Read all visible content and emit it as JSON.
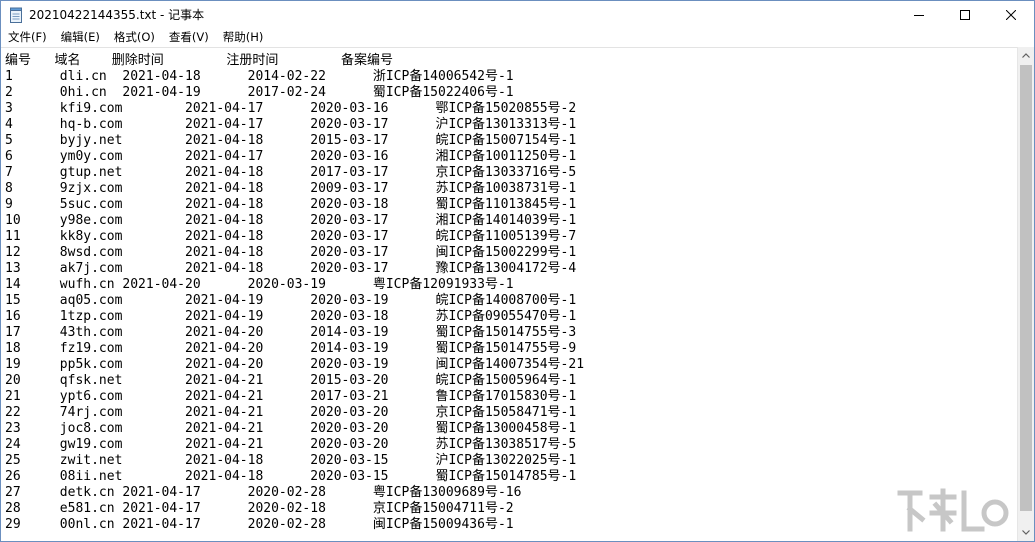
{
  "window": {
    "title": "20210422144355.txt - 记事本"
  },
  "menu": [
    {
      "label": "文件(F)"
    },
    {
      "label": "编辑(E)"
    },
    {
      "label": "格式(O)"
    },
    {
      "label": "查看(V)"
    },
    {
      "label": "帮助(H)"
    }
  ],
  "editor": {
    "lines": [
      "编号   域名    删除时间        注册时间        备案编号",
      "1      dli.cn  2021-04-18      2014-02-22      浙ICP备14006542号-1",
      "2      0hi.cn  2021-04-19      2017-02-24      蜀ICP备15022406号-1",
      "3      kfi9.com        2021-04-17      2020-03-16      鄂ICP备15020855号-2",
      "4      hq-b.com        2021-04-17      2020-03-17      沪ICP备13013313号-1",
      "5      byjy.net        2021-04-18      2015-03-17      皖ICP备15007154号-1",
      "6      ym0y.com        2021-04-17      2020-03-16      湘ICP备10011250号-1",
      "7      gtup.net        2021-04-18      2017-03-17      京ICP备13033716号-5",
      "8      9zjx.com        2021-04-18      2009-03-17      苏ICP备10038731号-1",
      "9      5suc.com        2021-04-18      2020-03-18      蜀ICP备11013845号-1",
      "10     y98e.com        2021-04-18      2020-03-17      湘ICP备14014039号-1",
      "11     kk8y.com        2021-04-18      2020-03-17      皖ICP备11005139号-7",
      "12     8wsd.com        2021-04-18      2020-03-17      闽ICP备15002299号-1",
      "13     ak7j.com        2021-04-18      2020-03-17      豫ICP备13004172号-4",
      "14     wufh.cn 2021-04-20      2020-03-19      粤ICP备12091933号-1",
      "15     aq05.com        2021-04-19      2020-03-19      皖ICP备14008700号-1",
      "16     1tzp.com        2021-04-19      2020-03-18      苏ICP备09055470号-1",
      "17     43th.com        2021-04-20      2014-03-19      蜀ICP备15014755号-3",
      "18     fz19.com        2021-04-20      2014-03-19      蜀ICP备15014755号-9",
      "19     pp5k.com        2021-04-20      2020-03-19      闽ICP备14007354号-21",
      "20     qfsk.net        2021-04-21      2015-03-20      皖ICP备15005964号-1",
      "21     ypt6.com        2021-04-21      2017-03-21      鲁ICP备17015830号-1",
      "22     74rj.com        2021-04-21      2020-03-20      京ICP备15058471号-1",
      "23     joc8.com        2021-04-21      2020-03-20      蜀ICP备13000458号-1",
      "24     gw19.com        2021-04-21      2020-03-20      苏ICP备13038517号-5",
      "25     zwit.net        2021-04-18      2020-03-15      沪ICP备13022025号-1",
      "26     08ii.net        2021-04-18      2020-03-15      蜀ICP备15014785号-1",
      "27     detk.cn 2021-04-17      2020-02-28      粤ICP备13009689号-16",
      "28     e581.cn 2021-04-17      2020-02-18      京ICP备15004711号-2",
      "29     00nl.cn 2021-04-17      2020-02-28      闽ICP备15009436号-1"
    ]
  },
  "icons": {
    "app": "notepad-icon",
    "minimize": "minimize-icon",
    "maximize": "maximize-icon",
    "close": "close-icon",
    "scroll_up": "scroll-up-arrow-icon",
    "scroll_down": "scroll-down-arrow-icon",
    "watermark": "site-watermark-logo"
  },
  "colors": {
    "window_border": "#6b8fbf",
    "scrollbar_track": "#f0f0f0",
    "scrollbar_thumb": "#c1c1c1",
    "text": "#000000"
  }
}
